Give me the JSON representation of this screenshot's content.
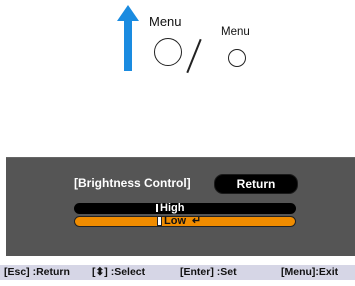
{
  "top": {
    "menu_label_large": "Menu",
    "menu_label_small": "Menu",
    "arrow_color": "#1a8be0"
  },
  "panel": {
    "title": "[Brightness Control]",
    "return_label": "Return",
    "options": [
      {
        "label": "High",
        "selected": false
      },
      {
        "label": "Low",
        "selected": true
      }
    ],
    "highlight_color": "#f08c00"
  },
  "footer": {
    "esc": "[Esc] :Return",
    "select": "[⬍] :Select",
    "enter": "[Enter] :Set",
    "menu": "[Menu]:Exit"
  }
}
